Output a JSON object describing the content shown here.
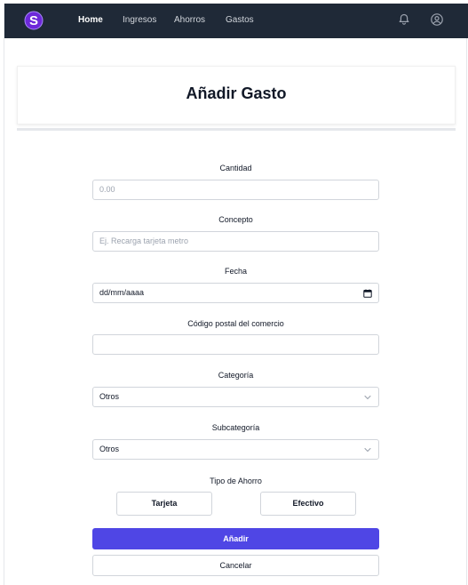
{
  "nav": {
    "logo_letter": "S",
    "links": [
      "Home",
      "Ingresos",
      "Ahorros",
      "Gastos"
    ],
    "active": "Home",
    "icons": [
      "bell-icon",
      "user-circle-icon"
    ]
  },
  "title": "Añadir Gasto",
  "form": {
    "cantidad": {
      "label": "Cantidad",
      "placeholder": "0.00"
    },
    "concepto": {
      "label": "Concepto",
      "placeholder": "Ej. Recarga tarjeta metro"
    },
    "fecha": {
      "label": "Fecha",
      "value": "dd/mm/aaaa"
    },
    "codigo_postal": {
      "label": "Código postal del comercio",
      "value": ""
    },
    "categoria": {
      "label": "Categoría",
      "value": "Otros"
    },
    "subcategoria": {
      "label": "Subcategoría",
      "value": "Otros"
    },
    "tipo_ahorro": {
      "label": "Tipo de Ahorro",
      "options": [
        "Tarjeta",
        "Efectivo"
      ]
    }
  },
  "actions": {
    "submit": "Añadir",
    "cancel": "Cancelar"
  },
  "colors": {
    "navbar": "#1f2937",
    "primary": "#4f46e5",
    "logo": "#7c3aed"
  }
}
